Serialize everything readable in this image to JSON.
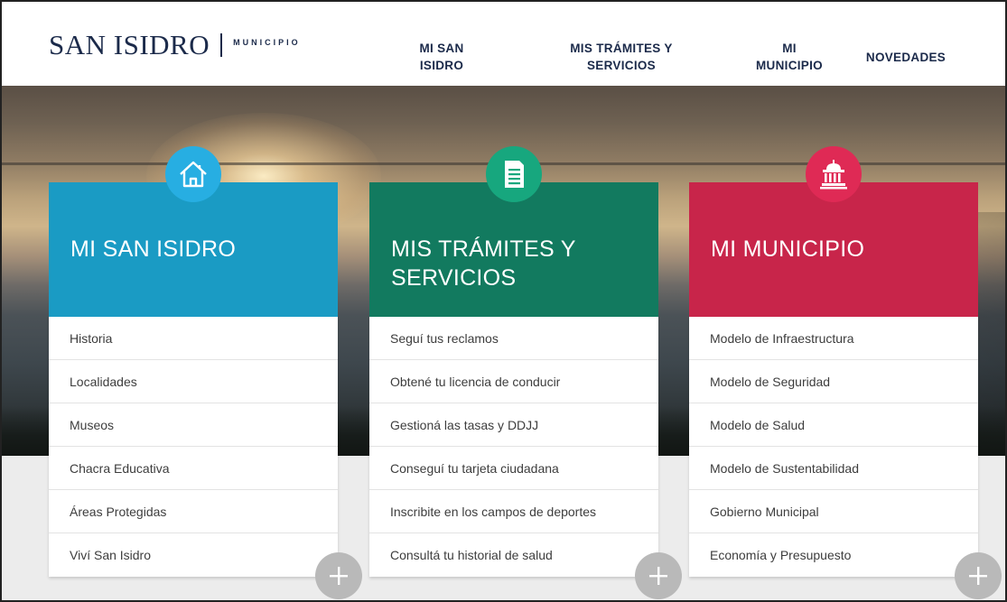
{
  "header": {
    "logo_main": "SAN ISIDRO",
    "logo_sub": "MUNICIPIO",
    "nav": [
      {
        "line1": "MI SAN",
        "line2": "ISIDRO"
      },
      {
        "line1": "MIS TRÁMITES Y",
        "line2": "SERVICIOS"
      },
      {
        "line1": "MI",
        "line2": "MUNICIPIO"
      },
      {
        "line1": "NOVEDADES",
        "line2": ""
      }
    ]
  },
  "cards": [
    {
      "title_line1": "MI SAN ISIDRO",
      "title_line2": "",
      "icon": "house-icon",
      "color": "#1a9bc4",
      "icon_color": "#27aee2",
      "items": [
        "Historia",
        "Localidades",
        "Museos",
        "Chacra Educativa",
        "Áreas Protegidas",
        "Viví San Isidro"
      ]
    },
    {
      "title_line1": "MIS TRÁMITES Y",
      "title_line2": "SERVICIOS",
      "icon": "document-icon",
      "color": "#127a5f",
      "icon_color": "#17a77e",
      "items": [
        "Seguí tus reclamos",
        "Obtené tu licencia de conducir",
        "Gestioná las tasas y DDJJ",
        "Conseguí tu tarjeta ciudadana",
        "Inscribite en los campos de deportes",
        "Consultá tu historial de salud"
      ]
    },
    {
      "title_line1": "MI MUNICIPIO",
      "title_line2": "",
      "icon": "building-icon",
      "color": "#c8254a",
      "icon_color": "#df2a55",
      "items": [
        "Modelo de Infraestructura",
        "Modelo de Seguridad",
        "Modelo de Salud",
        "Modelo de Sustentabilidad",
        "Gobierno Municipal",
        "Economía y Presupuesto"
      ]
    }
  ]
}
